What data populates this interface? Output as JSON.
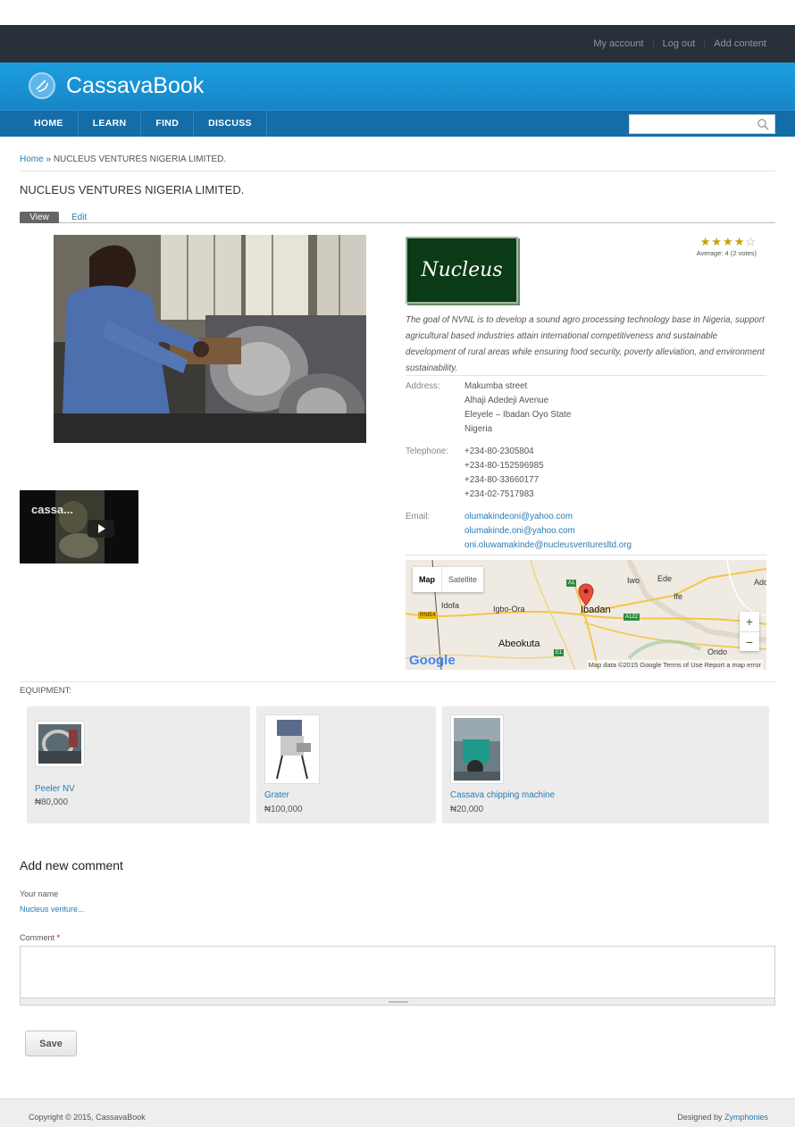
{
  "header": {
    "user_links": [
      "My account",
      "Log out",
      "Add content"
    ],
    "site_name": "CassavaBook",
    "nav": [
      "HOME",
      "LEARN",
      "FIND",
      "DISCUSS"
    ],
    "search_placeholder": ""
  },
  "breadcrumb": {
    "home": "Home",
    "separator": "»",
    "current": "NUCLEUS VENTURES NIGERIA LIMITED."
  },
  "page_title": "NUCLEUS VENTURES NIGERIA LIMITED.",
  "tabs": [
    "View",
    "Edit"
  ],
  "video": {
    "title": "cassa..."
  },
  "logo": {
    "text": "Nucleus"
  },
  "rating": {
    "stars_filled": 4,
    "stars_total": 5,
    "average_text": "Average: 4 (2 votes)"
  },
  "description": "The goal of NVNL is to develop a sound agro processing technology base in Nigeria, support agricultural based industries attain international competitiveness and sustainable development of rural areas while ensuring food security, poverty alleviation, and environment sustainability.",
  "address": {
    "label": "Address:",
    "lines": [
      "Makumba street",
      "Alhaji Adedeji Avenue",
      "Eleyele – Ibadan Oyo State",
      "Nigeria"
    ]
  },
  "telephone": {
    "label": "Telephone:",
    "numbers": [
      "+234-80-2305804",
      "+234-80-152596985",
      "+234-80-33660177",
      "+234-02-7517983"
    ]
  },
  "email": {
    "label": "Email:",
    "addresses": [
      "olumakindeoni@yahoo.com",
      "olumakinde.oni@yahoo.com",
      "oni.oluwamakinde@nucleusventuresltd.org"
    ]
  },
  "map": {
    "type_active": "Map",
    "type_inactive": "Satellite",
    "zoom_in": "+",
    "zoom_out": "−",
    "google": "Google",
    "attribution": "Map data ©2015 Google   Terms of Use   Report a map error",
    "places": [
      "Iwo",
      "Ede",
      "Ado",
      "Ife",
      "Igbo-Ora",
      "Ibadan",
      "Abeokuta",
      "Ondo",
      "Idofa"
    ],
    "shields": [
      "A1",
      "RNIE4",
      "A122",
      "E1"
    ]
  },
  "equipment": {
    "label": "EQUIPMENT:",
    "items": [
      {
        "name": "Peeler NV",
        "price": "₦80,000"
      },
      {
        "name": "Grater",
        "price": "₦100,000"
      },
      {
        "name": "Cassava chipping machine",
        "price": "₦20,000"
      }
    ]
  },
  "comment_form": {
    "title": "Add new comment",
    "name_label": "Your name",
    "name_value": "Nucleus venture...",
    "comment_label": "Comment",
    "required_mark": "*",
    "save_label": "Save"
  },
  "footer": {
    "copyright": "Copyright © 2015, CassavaBook",
    "designed_prefix": "Designed by ",
    "designer": "Zymphonies"
  }
}
